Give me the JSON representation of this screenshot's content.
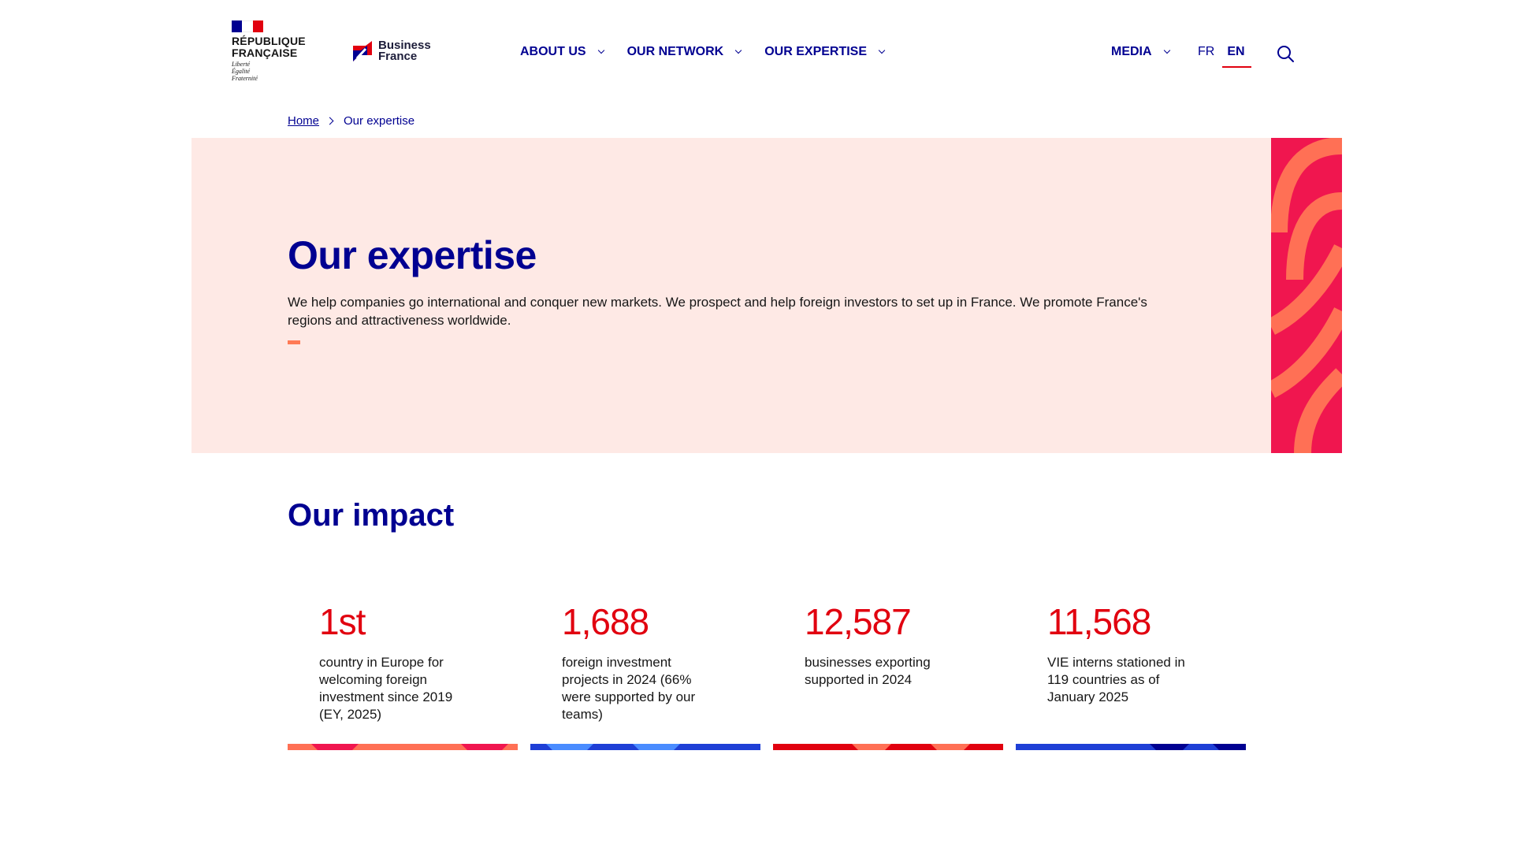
{
  "header": {
    "republic_name": "RÉPUBLIQUE\nFRANÇAISE",
    "republic_motto": "Liberté\nÉgalité\nFraternité",
    "brand_name": "Business\nFrance",
    "nav": [
      {
        "label": "ABOUT US"
      },
      {
        "label": "OUR NETWORK"
      },
      {
        "label": "OUR EXPERTISE"
      }
    ],
    "media_label": "MEDIA",
    "lang_fr": "FR",
    "lang_en": "EN",
    "colors": {
      "navy": "#000091",
      "red": "#e1000f",
      "hero_bg": "#fee9e5"
    }
  },
  "breadcrumb": {
    "home": "Home",
    "current": "Our expertise"
  },
  "hero": {
    "title": "Our expertise",
    "text": "We help companies go international and conquer new markets. We prospect and help foreign investors to set up in France. We promote France's regions and attractiveness worldwide."
  },
  "impact": {
    "title": "Our impact",
    "stats": [
      {
        "value": "1st",
        "description": "country in Europe for welcoming foreign investment since 2019 (EY, 2025)"
      },
      {
        "value": "1,688",
        "description": "foreign investment projects in 2024 (66% were supported by our teams)"
      },
      {
        "value": "12,587",
        "description": "businesses exporting supported in 2024"
      },
      {
        "value": "11,568",
        "description": "VIE interns stationed in 119 countries as of January 2025"
      }
    ]
  }
}
